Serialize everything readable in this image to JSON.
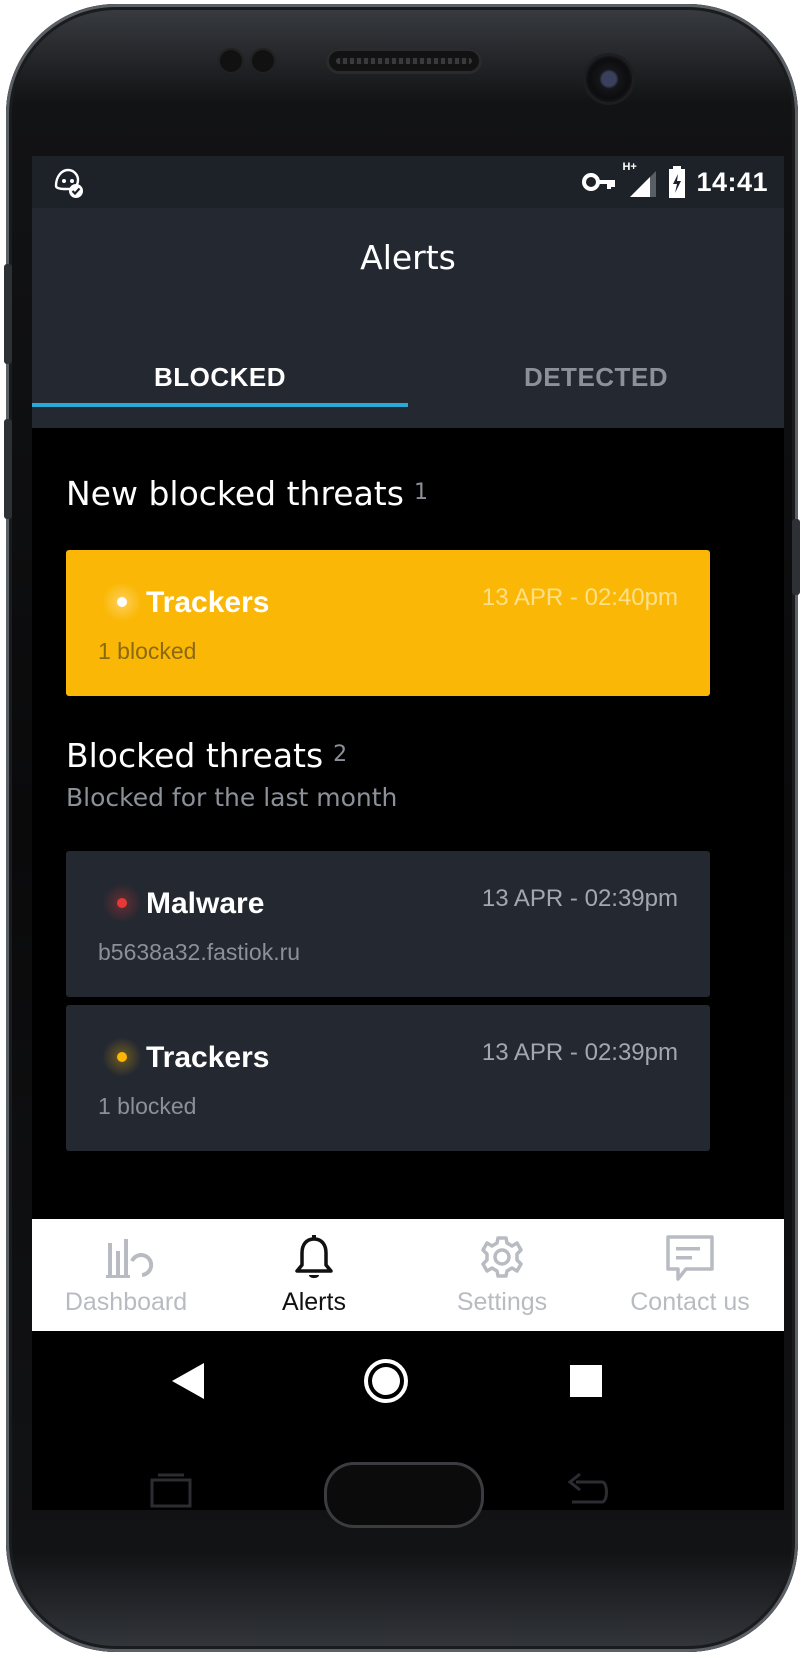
{
  "status_bar": {
    "time": "14:41",
    "network_label": "H+"
  },
  "app_bar": {
    "title": "Alerts",
    "tabs": [
      {
        "label": "BLOCKED",
        "active": true
      },
      {
        "label": "DETECTED",
        "active": false
      }
    ]
  },
  "new_section": {
    "title": "New blocked threats",
    "count": "1",
    "items": [
      {
        "name": "Trackers",
        "date": "13 APR - 02:40pm",
        "detail": "1 blocked",
        "dot_color": "#ffffff",
        "icon": "tracker-dot-icon"
      }
    ]
  },
  "blocked_section": {
    "title": "Blocked threats",
    "count": "2",
    "subtitle": "Blocked for the last month",
    "items": [
      {
        "name": "Malware",
        "date": "13 APR - 02:39pm",
        "detail": "b5638a32.fastiok.ru",
        "dot_color": "#e53935",
        "icon": "malware-dot-icon"
      },
      {
        "name": "Trackers",
        "date": "13 APR - 02:39pm",
        "detail": "1 blocked",
        "dot_color": "#fbb705",
        "icon": "tracker-dot-icon"
      }
    ]
  },
  "bottom_nav": {
    "items": [
      {
        "label": "Dashboard",
        "icon": "dashboard-icon",
        "active": false
      },
      {
        "label": "Alerts",
        "icon": "bell-icon",
        "active": true
      },
      {
        "label": "Settings",
        "icon": "gear-icon",
        "active": false
      },
      {
        "label": "Contact us",
        "icon": "chat-icon",
        "active": false
      }
    ]
  },
  "colors": {
    "accent": "#2aa8d6",
    "warning": "#fbb705",
    "danger": "#e53935",
    "card_bg": "#232831"
  }
}
